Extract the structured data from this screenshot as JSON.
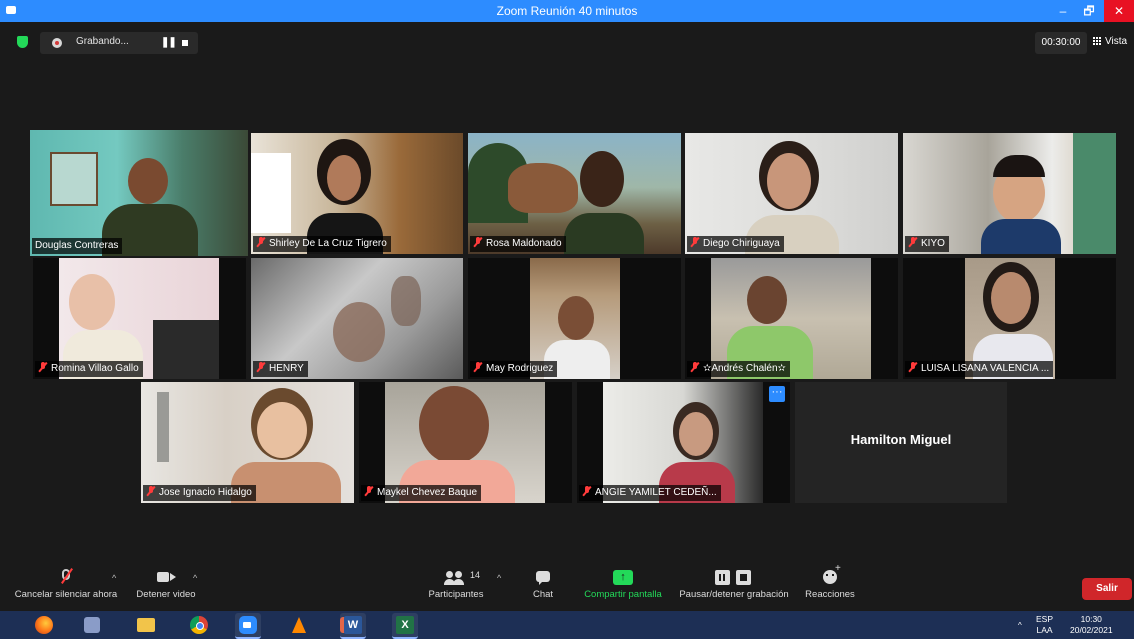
{
  "window": {
    "title": "Zoom Reunión 40 minutos",
    "minimize": "–",
    "maximize": "🗗",
    "close": "✕"
  },
  "topbar": {
    "recording_label": "Grabando...",
    "timer": "00:30:00",
    "view_label": "Vista"
  },
  "participants_row1": [
    {
      "name": "Douglas Contreras",
      "muted": false,
      "active": true
    },
    {
      "name": "Shirley De La Cruz Tigrero",
      "muted": true
    },
    {
      "name": "Rosa Maldonado",
      "muted": true
    },
    {
      "name": "Diego Chiriguaya",
      "muted": true
    },
    {
      "name": "KIYO",
      "muted": true
    }
  ],
  "participants_row2": [
    {
      "name": "Romina Villao Gallo",
      "muted": true
    },
    {
      "name": "HENRY",
      "muted": true
    },
    {
      "name": "May Rodriguez",
      "muted": true
    },
    {
      "name": "✫Andrés Chalén✫",
      "muted": true
    },
    {
      "name": "LUISA LISANA VALENCIA ...",
      "muted": true
    }
  ],
  "participants_row3": [
    {
      "name": "Jose Ignacio Hidalgo",
      "muted": true
    },
    {
      "name": "Maykel Chevez Baque",
      "muted": true
    },
    {
      "name": "ANGIE YAMILET CEDEÑ...",
      "muted": true
    },
    {
      "name": "Hamilton Miguel",
      "video_off": true
    }
  ],
  "toolbar": {
    "mute_label": "Cancelar silenciar ahora",
    "video_label": "Detener video",
    "participants_label": "Participantes",
    "participants_count": "14",
    "chat_label": "Chat",
    "share_label": "Compartir pantalla",
    "record_label": "Pausar/detener grabación",
    "reactions_label": "Reacciones",
    "leave_label": "Salir"
  },
  "taskbar": {
    "lang_top": "ESP",
    "lang_bottom": "LAA",
    "time": "10:30",
    "date": "20/02/2021"
  },
  "colors": {
    "zoom_blue": "#2d8cff",
    "active_speaker": "#c4e86a",
    "share_green": "#23d959",
    "leave_red": "#d0262a"
  }
}
